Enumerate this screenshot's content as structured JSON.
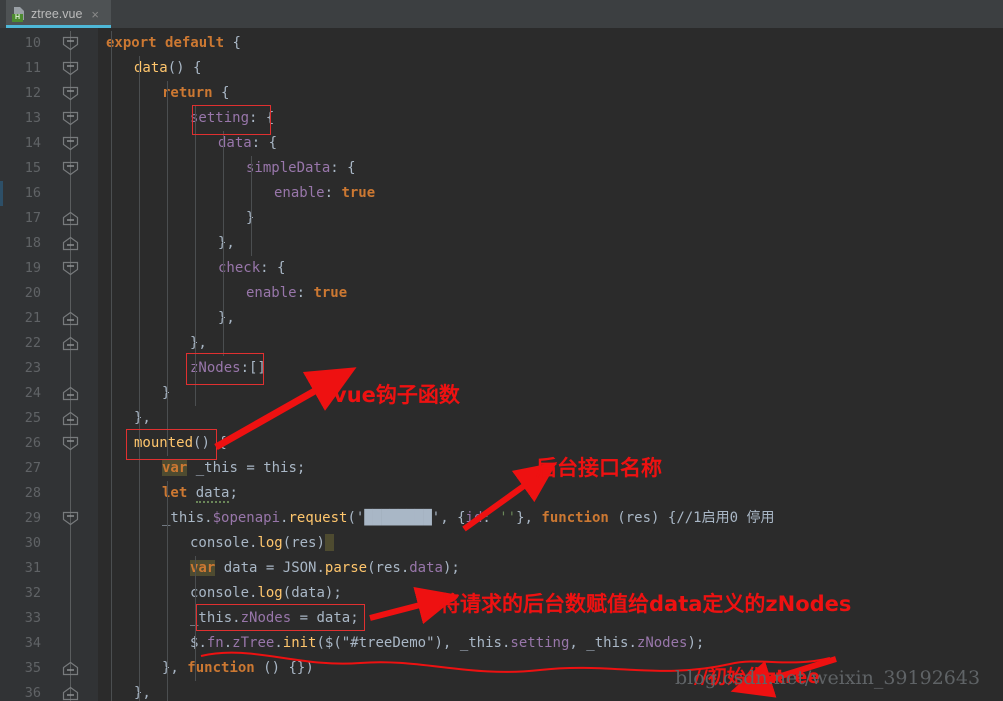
{
  "window": {
    "app": "IDE code editor",
    "theme_background": "#2b2b2b",
    "accent": "#4eb8d8"
  },
  "tab": {
    "filename": "ztree.vue",
    "icon": "vue-file-icon",
    "icon_badge": "H",
    "close_label": "×",
    "active": true
  },
  "editor": {
    "first_line": 10,
    "last_line": 36,
    "lines": [
      {
        "n": 10,
        "fold": "collapse-down",
        "indent": 0,
        "text": "export default {"
      },
      {
        "n": 11,
        "fold": "collapse-down",
        "indent": 1,
        "text": "data() {"
      },
      {
        "n": 12,
        "fold": "collapse-down",
        "indent": 2,
        "text": "return {"
      },
      {
        "n": 13,
        "fold": "collapse-down",
        "indent": 3,
        "text": "setting: {"
      },
      {
        "n": 14,
        "fold": "collapse-down",
        "indent": 4,
        "text": "data: {"
      },
      {
        "n": 15,
        "fold": "collapse-down",
        "indent": 5,
        "text": "simpleData: {"
      },
      {
        "n": 16,
        "fold": "none",
        "indent": 6,
        "text": "enable: true"
      },
      {
        "n": 17,
        "fold": "collapse-up",
        "indent": 5,
        "text": "}"
      },
      {
        "n": 18,
        "fold": "collapse-up",
        "indent": 4,
        "text": "},"
      },
      {
        "n": 19,
        "fold": "collapse-down",
        "indent": 4,
        "text": "check: {"
      },
      {
        "n": 20,
        "fold": "none",
        "indent": 5,
        "text": "enable: true"
      },
      {
        "n": 21,
        "fold": "collapse-up",
        "indent": 4,
        "text": "},"
      },
      {
        "n": 22,
        "fold": "collapse-up",
        "indent": 3,
        "text": "},"
      },
      {
        "n": 23,
        "fold": "none",
        "indent": 3,
        "text": "zNodes:[]"
      },
      {
        "n": 24,
        "fold": "collapse-up",
        "indent": 2,
        "text": "}"
      },
      {
        "n": 25,
        "fold": "collapse-up",
        "indent": 1,
        "text": "},"
      },
      {
        "n": 26,
        "fold": "collapse-down",
        "indent": 1,
        "text": "mounted() {"
      },
      {
        "n": 27,
        "fold": "none",
        "indent": 2,
        "text": "var _this = this;"
      },
      {
        "n": 28,
        "fold": "none",
        "indent": 2,
        "text": "let data;"
      },
      {
        "n": 29,
        "fold": "collapse-down",
        "indent": 2,
        "text": "_this.$openapi.request('████████', {id: ''}, function (res) {//1启用0 停用"
      },
      {
        "n": 30,
        "fold": "none",
        "indent": 3,
        "text": "console.log(res)"
      },
      {
        "n": 31,
        "fold": "none",
        "indent": 3,
        "text": "var data = JSON.parse(res.data);"
      },
      {
        "n": 32,
        "fold": "none",
        "indent": 3,
        "text": "console.log(data);"
      },
      {
        "n": 33,
        "fold": "none",
        "indent": 3,
        "text": "_this.zNodes = data;"
      },
      {
        "n": 34,
        "fold": "none",
        "indent": 3,
        "text": "$.fn.zTree.init($(\"#treeDemo\"), _this.setting, _this.zNodes);"
      },
      {
        "n": 35,
        "fold": "collapse-up",
        "indent": 2,
        "text": "}, function () {})"
      },
      {
        "n": 36,
        "fold": "collapse-up",
        "indent": 1,
        "text": "},"
      }
    ],
    "redacted_string_note": "API url blurred out",
    "highlighted_token": "#treeDemo",
    "inline_comment": "//1启用0 停用"
  },
  "annotations": {
    "boxes": [
      {
        "name": "setting-box",
        "target": "setting:"
      },
      {
        "name": "znodes-box",
        "target": "zNodes:"
      },
      {
        "name": "mounted-box",
        "target": "mounted()"
      },
      {
        "name": "assign-znodes-box",
        "target": "_this.zNodes = data;"
      }
    ],
    "labels": [
      {
        "name": "vue-hook-label",
        "text": "vue钩子函数"
      },
      {
        "name": "backend-api-label",
        "text": "后台接口名称"
      },
      {
        "name": "assign-data-label",
        "text": "将请求的后台数赋值给data定义的zNodes"
      },
      {
        "name": "init-ztree-label",
        "text": "//初始化ztree"
      }
    ],
    "color": "#ee1111"
  },
  "watermark": {
    "text": "blog.csdn.net/weixin_39192643"
  }
}
